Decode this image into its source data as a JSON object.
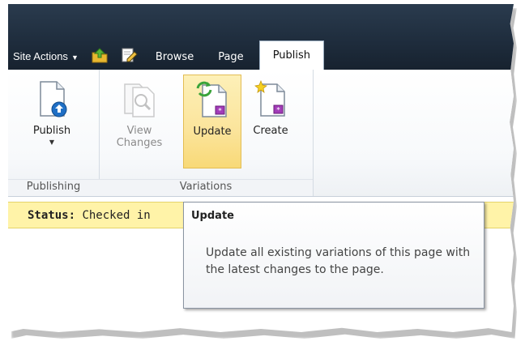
{
  "header": {
    "site_actions": "Site Actions",
    "tabs": [
      "Browse",
      "Page",
      "Publish"
    ],
    "active_tab": "Publish"
  },
  "ribbon": {
    "publishing": {
      "publish_label": "Publish",
      "group_label": "Publishing"
    },
    "variations": {
      "view_changes_line1": "View",
      "view_changes_line2": "Changes",
      "update_label": "Update",
      "create_label": "Create",
      "group_label": "Variations"
    }
  },
  "status": {
    "label": "Status:",
    "value": "Checked in"
  },
  "tooltip": {
    "title": "Update",
    "body": "Update all existing variations of this page with the latest changes to the page."
  },
  "colors": {
    "header_bg": "#1e2c3c",
    "status_bg": "#fff3a8",
    "hover_bg": "#fbe49b"
  }
}
